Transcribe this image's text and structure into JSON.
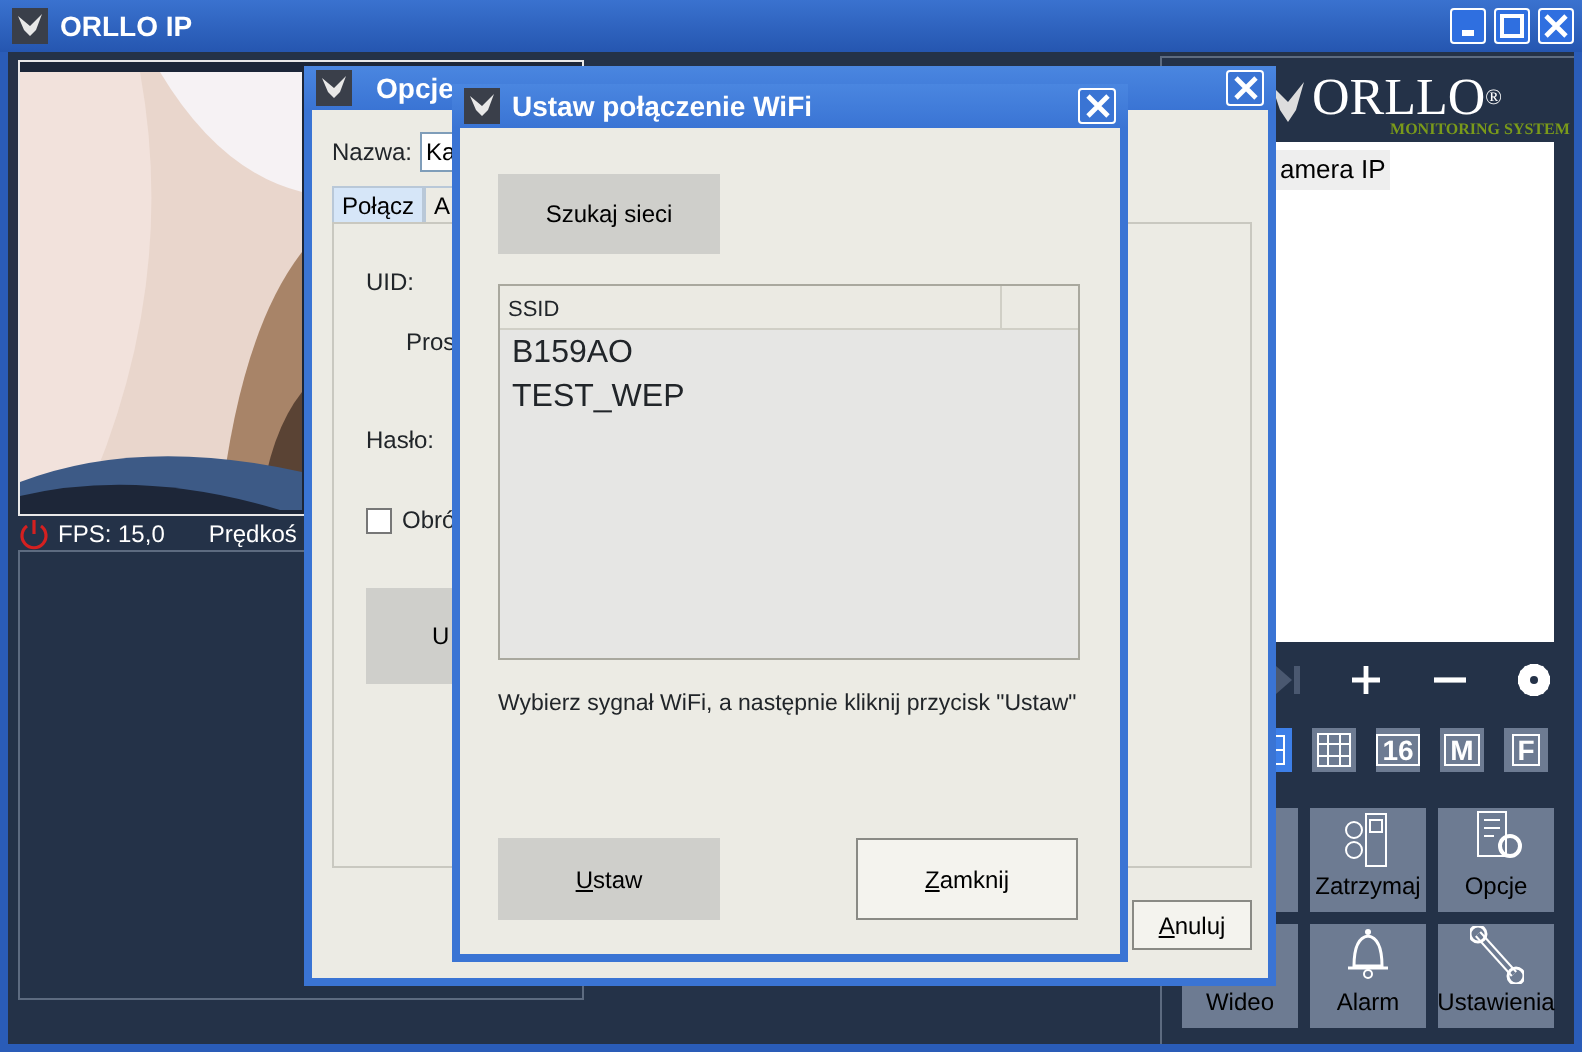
{
  "window": {
    "title": "ORLLO IP"
  },
  "camera_view": {
    "fps": "FPS: 15,0",
    "speed": "Prędkoś"
  },
  "logo": {
    "name": "ORLLO$^{®}$",
    "tagline": "MONITORING SYSTEM"
  },
  "camera_list": [
    {
      "label": "amera IP",
      "selected": true
    }
  ],
  "layout_buttons": [
    {
      "kind": "quad",
      "selected": true
    },
    {
      "kind": "grid",
      "selected": false
    },
    {
      "kind": "text",
      "label": "16",
      "selected": false
    },
    {
      "kind": "text",
      "label": "M",
      "selected": false
    },
    {
      "kind": "text",
      "label": "F",
      "selected": false
    }
  ],
  "tiles": [
    {
      "kind": "blank"
    },
    {
      "kind": "stop",
      "label": "Zatrzymaj"
    },
    {
      "kind": "options",
      "label": "Opcje"
    },
    {
      "kind": "video",
      "label": "Wideo"
    },
    {
      "kind": "alarm",
      "label": "Alarm"
    },
    {
      "kind": "settings",
      "label": "Ustawienia"
    }
  ],
  "options_dialog": {
    "title": "Opcje",
    "name_label": "Nazwa:",
    "name_value": "Ka",
    "tabs": [
      {
        "label": "Połącz",
        "selected": true
      },
      {
        "label": "A",
        "selected": false
      }
    ],
    "uid_label": "UID:",
    "partial_label": "Pros",
    "password_label": "Hasło:",
    "checkbox": {
      "label": "Obró",
      "checked": false
    },
    "partial_button": "U",
    "cancel_button": "Anuluj"
  },
  "wifi_dialog": {
    "title": "Ustaw połączenie WiFi",
    "scan_button": "Szukaj sieci",
    "columns": [
      "SSID"
    ],
    "rows": [
      "B159AO",
      "TEST_WEP"
    ],
    "hint": "Wybierz sygnał WiFi, a następnie kliknij przycisk \"Ustaw\"",
    "set_button": "Ustaw",
    "close_button": "Zamknij"
  }
}
